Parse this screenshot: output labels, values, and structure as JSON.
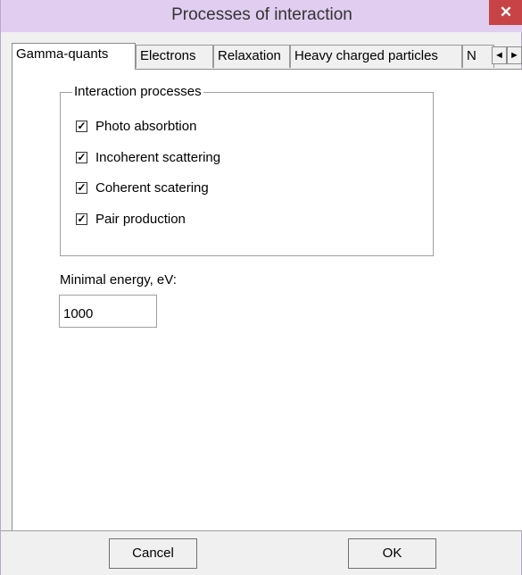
{
  "window": {
    "title": "Processes of interaction",
    "close_glyph": "✕"
  },
  "tabs": [
    {
      "label": "Gamma-quants",
      "active": true
    },
    {
      "label": "Electrons"
    },
    {
      "label": "Relaxation"
    },
    {
      "label": "Heavy charged particles"
    },
    {
      "label": "N"
    }
  ],
  "tab_scroll": {
    "left": "◄",
    "right": "►"
  },
  "group": {
    "legend": "Interaction processes",
    "items": [
      {
        "label": "Photo absorbtion",
        "checked": true,
        "mark": "✓"
      },
      {
        "label": "Incoherent scattering",
        "checked": true,
        "mark": "✓"
      },
      {
        "label": "Coherent scatering",
        "checked": true,
        "mark": "✓"
      },
      {
        "label": "Pair production",
        "checked": true,
        "mark": "✓"
      }
    ]
  },
  "energy": {
    "label": "Minimal energy, eV:",
    "value": "1000"
  },
  "buttons": {
    "cancel": "Cancel",
    "ok": "OK"
  }
}
